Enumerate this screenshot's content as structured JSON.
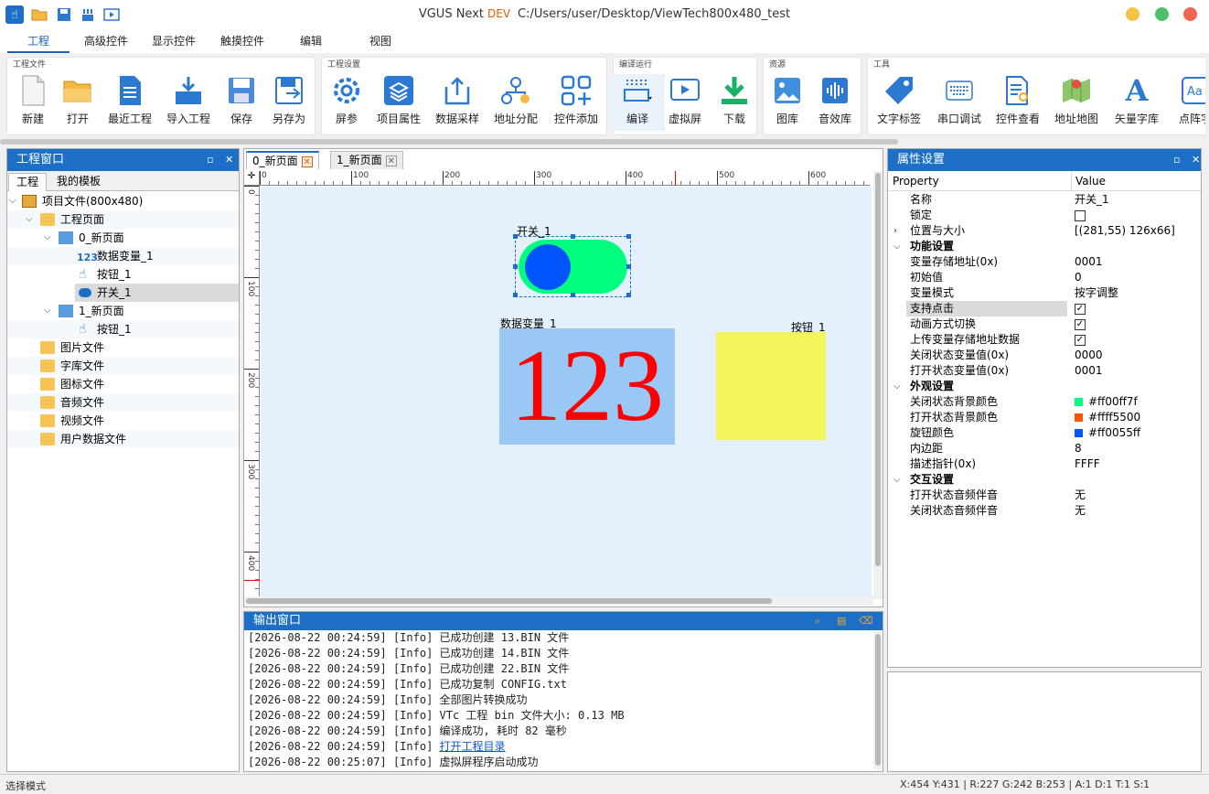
{
  "titlebar": {
    "app_name": "VGUS Next",
    "edition": "DEV",
    "path": "C:/Users/user/Desktop/ViewTech800x480_test",
    "quick_access": [
      "touch-icon",
      "open-folder-icon",
      "save-icon",
      "compile-icon",
      "preview-icon"
    ],
    "window_buttons": {
      "minimize_color": "#f5c342",
      "maximize_color": "#4cc06a",
      "close_color": "#f0654f"
    }
  },
  "menu": [
    "工程",
    "高级控件",
    "显示控件",
    "触摸控件",
    "编辑",
    "视图"
  ],
  "menu_active": 0,
  "ribbon": {
    "groups": [
      {
        "label": "工程文件",
        "buttons": [
          "新建",
          "打开",
          "最近工程",
          "导入工程",
          "保存",
          "另存为"
        ]
      },
      {
        "label": "工程设置",
        "buttons": [
          "屏参",
          "项目属性",
          "数据采样",
          "地址分配",
          "控件添加"
        ]
      },
      {
        "label": "编译运行",
        "buttons": [
          "编译",
          "虚拟屏",
          "下载"
        ]
      },
      {
        "label": "资源",
        "buttons": [
          "图库",
          "音效库"
        ]
      },
      {
        "label": "工具",
        "buttons": [
          "文字标签",
          "串口调试",
          "控件查看",
          "地址地图",
          "矢量字库",
          "点阵字"
        ]
      }
    ]
  },
  "project_window": {
    "title": "工程窗口",
    "tabs": [
      "工程",
      "我的模板"
    ],
    "tree": [
      {
        "label": "项目文件(800x480)",
        "level": 0,
        "icon": "project-icon",
        "expanded": true
      },
      {
        "label": "工程页面",
        "level": 1,
        "icon": "folder-icon",
        "expanded": true
      },
      {
        "label": "0_新页面",
        "level": 2,
        "icon": "page-icon",
        "expanded": true
      },
      {
        "label": "数据变量_1",
        "level": 3,
        "icon": "number-icon"
      },
      {
        "label": "按钮_1",
        "level": 3,
        "icon": "hand-icon"
      },
      {
        "label": "开关_1",
        "level": 3,
        "icon": "switch-icon",
        "selected": true
      },
      {
        "label": "1_新页面",
        "level": 2,
        "icon": "page-icon",
        "expanded": true
      },
      {
        "label": "按钮_1",
        "level": 3,
        "icon": "hand-icon"
      },
      {
        "label": "图片文件",
        "level": 1,
        "icon": "folder-icon"
      },
      {
        "label": "字库文件",
        "level": 1,
        "icon": "folder-icon"
      },
      {
        "label": "图标文件",
        "level": 1,
        "icon": "folder-icon"
      },
      {
        "label": "音频文件",
        "level": 1,
        "icon": "folder-icon"
      },
      {
        "label": "视频文件",
        "level": 1,
        "icon": "folder-icon"
      },
      {
        "label": "用户数据文件",
        "level": 1,
        "icon": "folder-icon"
      }
    ]
  },
  "editor": {
    "tabs": [
      {
        "label": "0_新页面",
        "active": true
      },
      {
        "label": "1_新页面",
        "active": false
      }
    ],
    "ruler_h": [
      "0",
      "100",
      "200",
      "300",
      "400",
      "500",
      "600"
    ],
    "ruler_v": [
      "0",
      "100",
      "200",
      "300",
      "400"
    ],
    "widgets": {
      "switch_label": "开关_1",
      "number_label": "数据变量_1",
      "number_value": "123",
      "button_label": "按钮_1",
      "switch_bg_color": "#00ff7f",
      "knob_color": "#0055ff",
      "number_bg_color": "#99c8f5",
      "number_text_color": "#ff0000",
      "button_color": "#f2f55a"
    }
  },
  "output": {
    "title": "输出窗口",
    "lines": [
      {
        "text": "[2026-08-22 00:24:59] [Info] 已成功创建 13.BIN 文件"
      },
      {
        "text": "[2026-08-22 00:24:59] [Info] 已成功创建 14.BIN 文件"
      },
      {
        "text": "[2026-08-22 00:24:59] [Info] 已成功创建 22.BIN 文件"
      },
      {
        "text": "[2026-08-22 00:24:59] [Info] 已成功复制 CONFIG.txt"
      },
      {
        "text": "[2026-08-22 00:24:59] [Info] 全部图片转换成功"
      },
      {
        "text": "[2026-08-22 00:24:59] [Info] VTc 工程 bin 文件大小: 0.13 MB"
      },
      {
        "text": "[2026-08-22 00:24:59] [Info] 编译成功, 耗时 82 毫秒"
      },
      {
        "prefix": "[2026-08-22 00:24:59] [Info] ",
        "link": "打开工程目录"
      },
      {
        "text": "[2026-08-22 00:25:07] [Info] 虚拟屏程序启动成功"
      }
    ]
  },
  "properties": {
    "title": "属性设置",
    "col_property": "Property",
    "col_value": "Value",
    "rows": [
      {
        "name": "名称",
        "value": "开关_1"
      },
      {
        "name": "锁定",
        "check": false
      },
      {
        "name": "位置与大小",
        "value": "[(281,55) 126x66]",
        "expandable": true
      },
      {
        "name": "功能设置",
        "category": true
      },
      {
        "name": "变量存储地址(0x)",
        "value": "0001"
      },
      {
        "name": "初始值",
        "value": "0"
      },
      {
        "name": "变量模式",
        "value": "按字调整"
      },
      {
        "name": "支持点击",
        "check": true,
        "highlight": true
      },
      {
        "name": "动画方式切换",
        "check": true
      },
      {
        "name": "上传变量存储地址数据",
        "check": true
      },
      {
        "name": "关闭状态变量值(0x)",
        "value": "0000"
      },
      {
        "name": "打开状态变量值(0x)",
        "value": "0001"
      },
      {
        "name": "外观设置",
        "category": true
      },
      {
        "name": "关闭状态背景颜色",
        "value": "#ff00ff7f",
        "swatch": "#00ff7f"
      },
      {
        "name": "打开状态背景颜色",
        "value": "#ffff5500",
        "swatch": "#ff5500"
      },
      {
        "name": "旋钮颜色",
        "value": "#ff0055ff",
        "swatch": "#0055ff"
      },
      {
        "name": "内边距",
        "value": "8"
      },
      {
        "name": "描述指针(0x)",
        "value": "FFFF"
      },
      {
        "name": "交互设置",
        "category": true
      },
      {
        "name": "打开状态音频伴音",
        "value": "无"
      },
      {
        "name": "关闭状态音频伴音",
        "value": "无"
      }
    ]
  },
  "statusbar": {
    "left": "选择模式",
    "right": "X:454  Y:431  |  R:227 G:242 B:253  |  A:1  D:1  T:1  S:1"
  }
}
